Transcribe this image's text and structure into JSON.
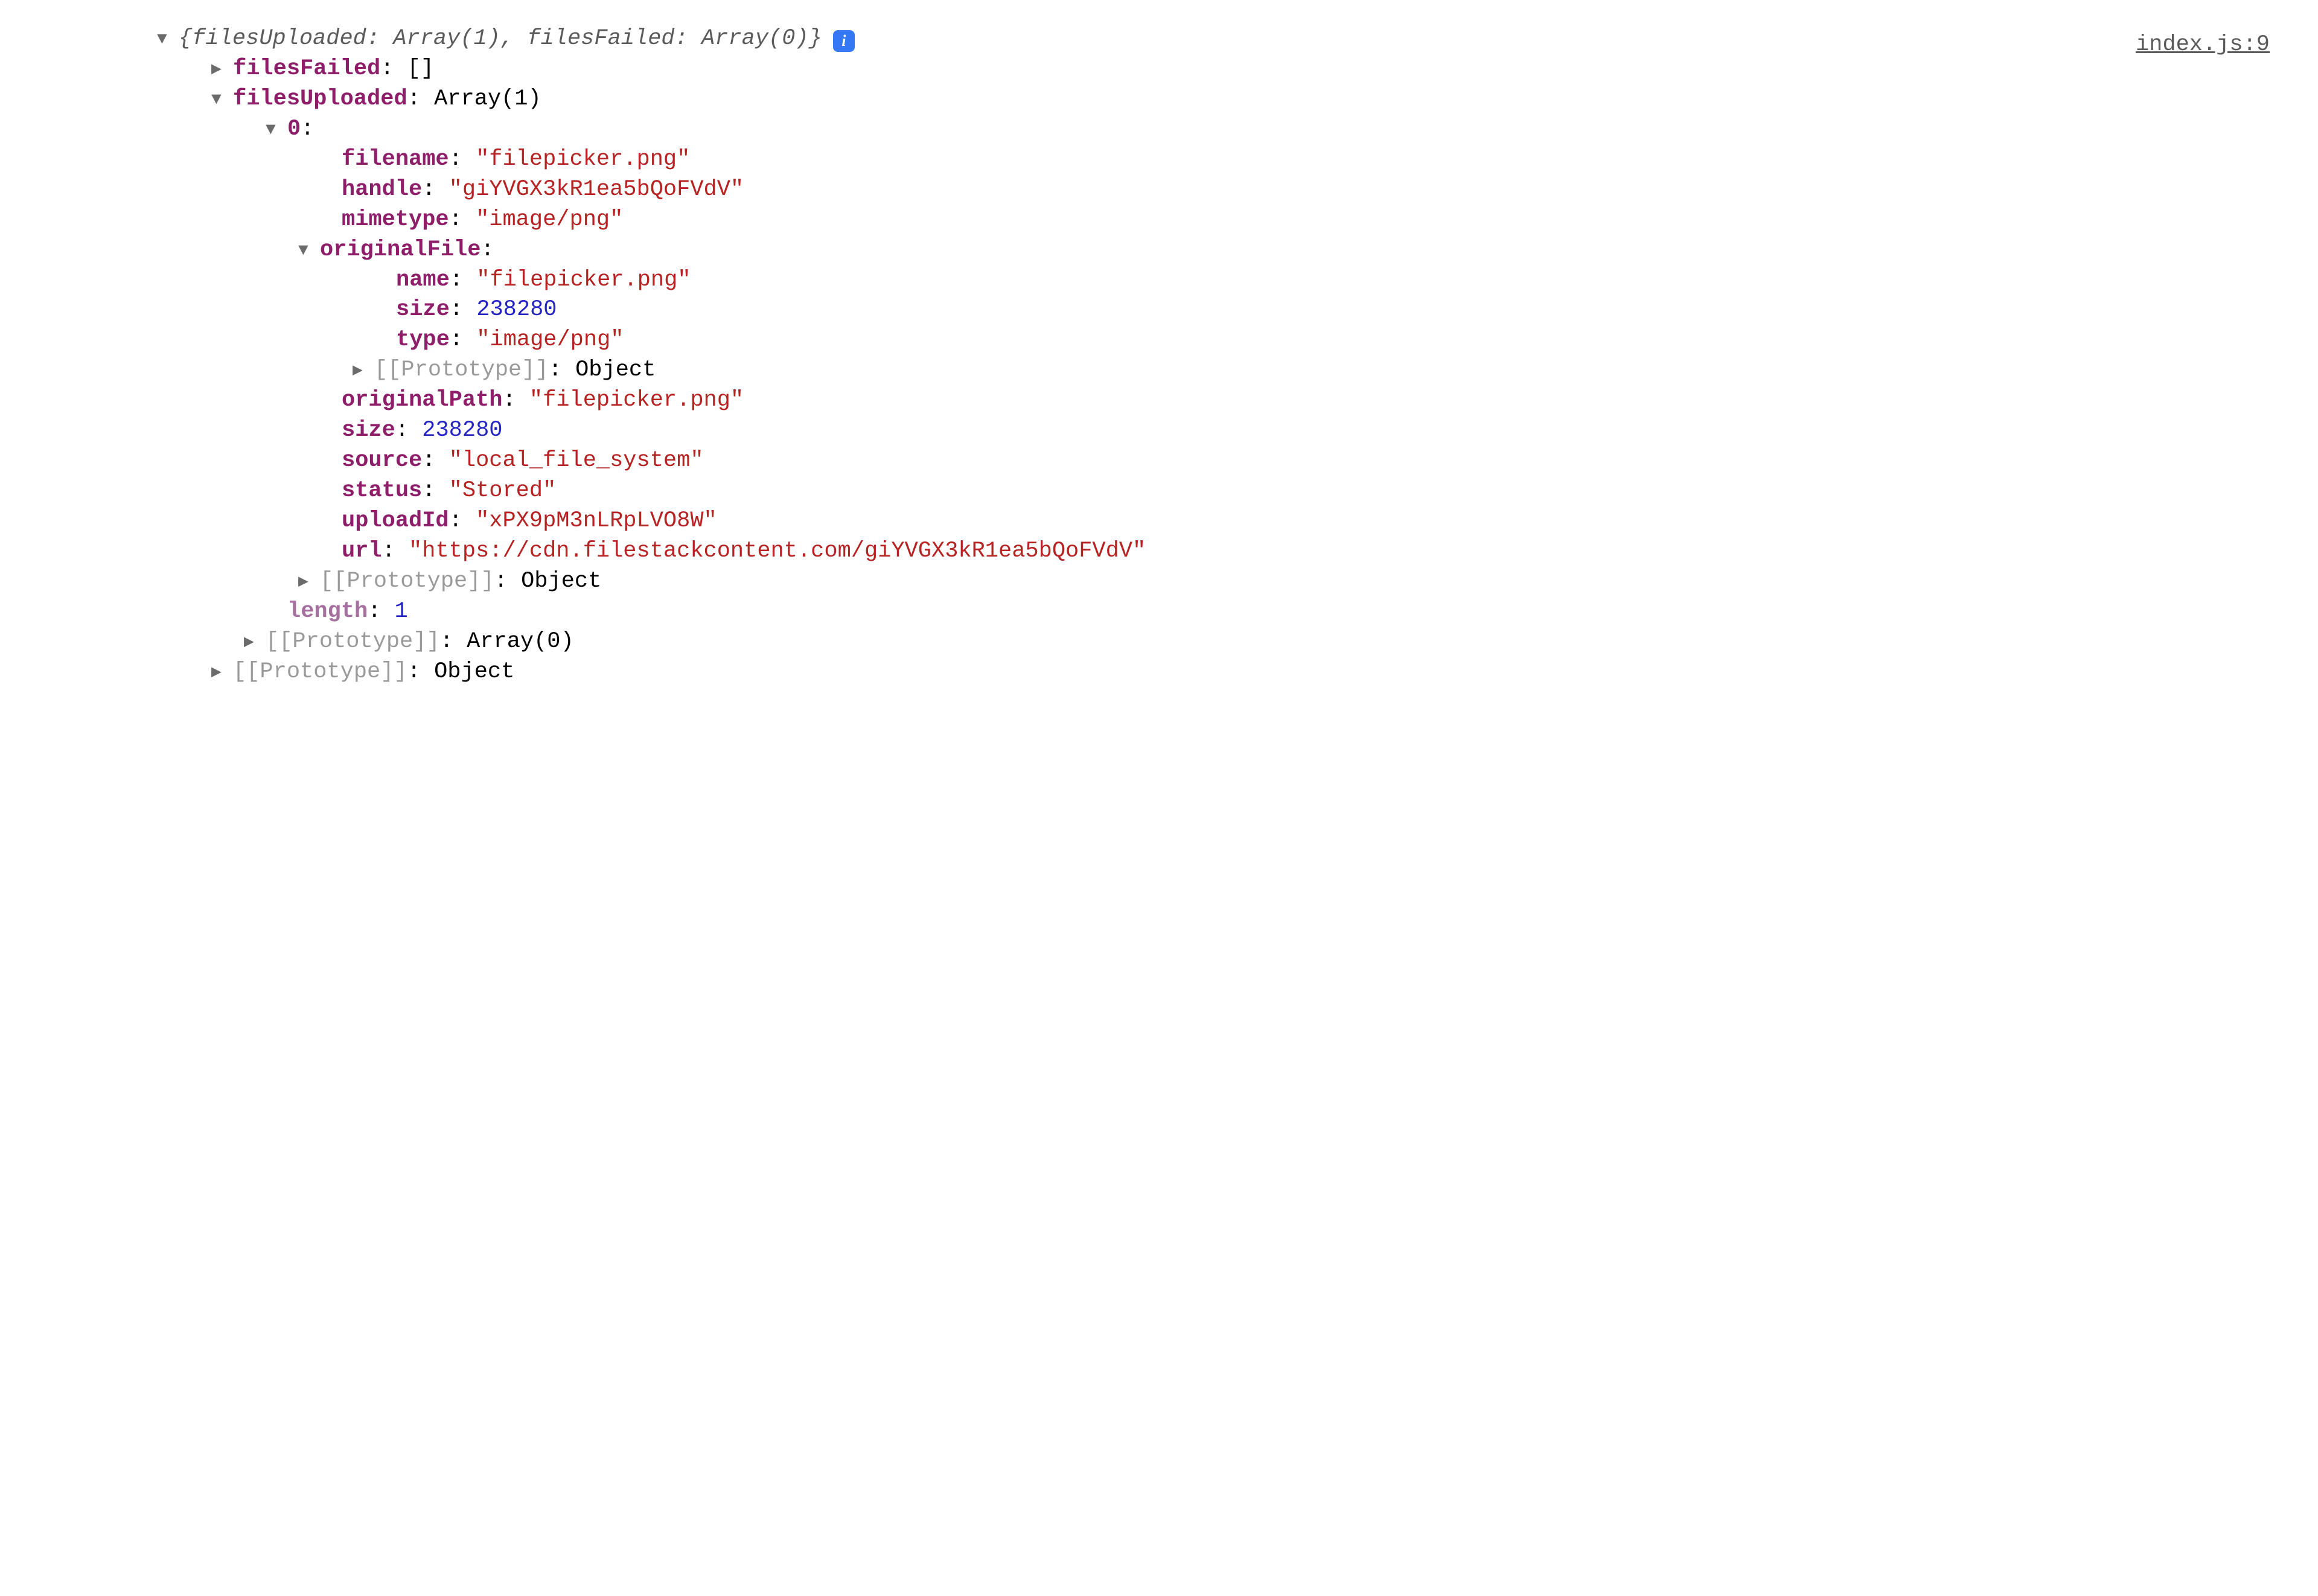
{
  "sourceLink": "index.js:9",
  "summary": {
    "open": "{",
    "k1": "filesUploaded",
    "v1": "Array(1)",
    "sep": ", ",
    "k2": "filesFailed",
    "v2": "Array(0)",
    "close": "}"
  },
  "rows": {
    "filesFailed": {
      "key": "filesFailed",
      "value": "[]"
    },
    "filesUploaded": {
      "key": "filesUploaded",
      "value": "Array(1)"
    },
    "index0": {
      "key": "0",
      "value": ""
    },
    "filename": {
      "key": "filename",
      "value": "\"filepicker.png\""
    },
    "handle": {
      "key": "handle",
      "value": "\"giYVGX3kR1ea5bQoFVdV\""
    },
    "mimetype": {
      "key": "mimetype",
      "value": "\"image/png\""
    },
    "originalFile": {
      "key": "originalFile",
      "value": ""
    },
    "of_name": {
      "key": "name",
      "value": "\"filepicker.png\""
    },
    "of_size": {
      "key": "size",
      "value": "238280"
    },
    "of_type": {
      "key": "type",
      "value": "\"image/png\""
    },
    "of_proto": {
      "key": "[[Prototype]]",
      "value": "Object"
    },
    "originalPath": {
      "key": "originalPath",
      "value": "\"filepicker.png\""
    },
    "size": {
      "key": "size",
      "value": "238280"
    },
    "source": {
      "key": "source",
      "value": "\"local_file_system\""
    },
    "status": {
      "key": "status",
      "value": "\"Stored\""
    },
    "uploadId": {
      "key": "uploadId",
      "value": "\"xPX9pM3nLRpLVO8W\""
    },
    "url": {
      "key": "url",
      "value": "\"https://cdn.filestackcontent.com/giYVGX3kR1ea5bQoFVdV\""
    },
    "item0_proto": {
      "key": "[[Prototype]]",
      "value": "Object"
    },
    "length": {
      "key": "length",
      "value": "1"
    },
    "arr_proto": {
      "key": "[[Prototype]]",
      "value": "Array(0)"
    },
    "root_proto": {
      "key": "[[Prototype]]",
      "value": "Object"
    }
  },
  "glyphs": {
    "down": "▼",
    "right": "▶",
    "info": "i"
  }
}
